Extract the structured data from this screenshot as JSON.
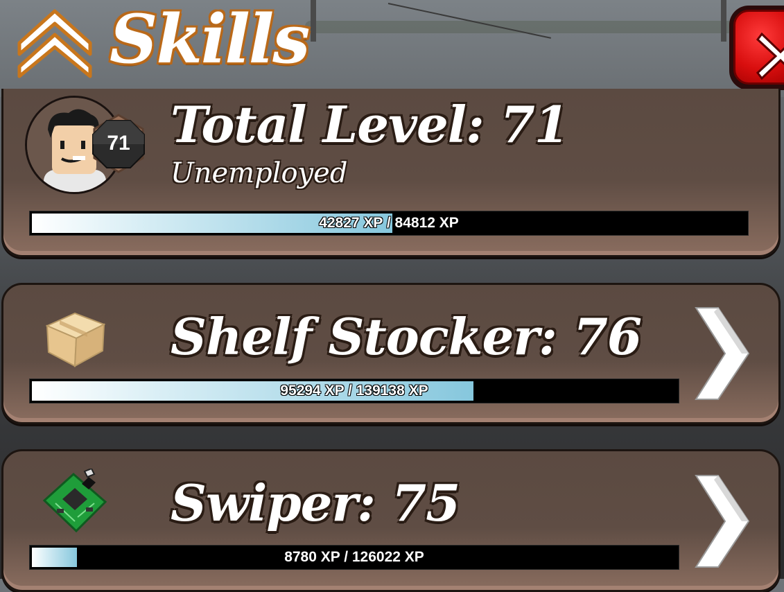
{
  "header": {
    "title": "Skills"
  },
  "total": {
    "title": "Total Level: 71",
    "level_badge": "71",
    "job": "Unemployed",
    "xp_text": "42827 XP / 84812 XP",
    "xp_current": 42827,
    "xp_max": 84812
  },
  "skills": [
    {
      "title": "Shelf Stocker: 76",
      "xp_text": "95294 XP / 139138 XP",
      "xp_current": 95294,
      "xp_max": 139138,
      "icon": "cardboard-box-icon"
    },
    {
      "title": "Swiper: 75",
      "xp_text": "8780 XP / 126022 XP",
      "xp_current": 8780,
      "xp_max": 126022,
      "icon": "circuit-board-icon"
    }
  ],
  "colors": {
    "panel": "#5b4a41",
    "title_outline": "#b8681a",
    "close_red": "#d80e0e",
    "xp_fill": "#86c7dd"
  }
}
